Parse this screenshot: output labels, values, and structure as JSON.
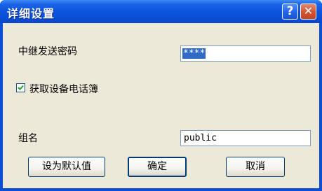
{
  "window": {
    "title": "详细设置",
    "help_symbol": "?",
    "close_symbol": "✕"
  },
  "form": {
    "password_label": "中继发送密码",
    "password_value": "****",
    "checkbox_label": "获取设备电话簿",
    "checkbox_checked": true,
    "group_label": "组名",
    "group_value": "public"
  },
  "buttons": {
    "default_label": "设为默认值",
    "ok_label": "确定",
    "cancel_label": "取消"
  }
}
